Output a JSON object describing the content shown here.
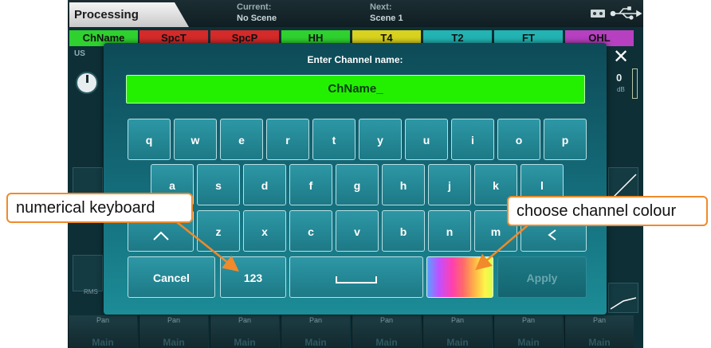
{
  "header": {
    "section": "Processing",
    "current_label": "Current:",
    "current_value": "No Scene",
    "next_label": "Next:",
    "next_value": "Scene 1"
  },
  "channel_tabs": [
    {
      "label": "ChName",
      "color": "#2fd12f"
    },
    {
      "label": "SpcT",
      "color": "#d42a2a"
    },
    {
      "label": "SpcP",
      "color": "#d42a2a"
    },
    {
      "label": "HH",
      "color": "#2fd12f"
    },
    {
      "label": "T4",
      "color": "#d8d21f"
    },
    {
      "label": "T2",
      "color": "#23b3b3"
    },
    {
      "label": "FT",
      "color": "#23b3b3"
    },
    {
      "label": "OHL",
      "color": "#b640c0"
    }
  ],
  "strip": {
    "left_label": "US",
    "meter_value": "0",
    "meter_unit": "dB",
    "rms_label": "RMS"
  },
  "pan_labels": [
    "Pan",
    "Pan",
    "Pan",
    "Pan",
    "Pan",
    "Pan",
    "Pan",
    "Pan"
  ],
  "pan_mains": [
    "Main",
    "Main",
    "Main",
    "Main",
    "Main",
    "Main",
    "Main",
    "Main"
  ],
  "dialog": {
    "title": "Enter Channel name:",
    "value": "ChName_",
    "field_color": "#22f000",
    "row1": [
      "q",
      "w",
      "e",
      "r",
      "t",
      "y",
      "u",
      "i",
      "o",
      "p"
    ],
    "row2": [
      "a",
      "s",
      "d",
      "f",
      "g",
      "h",
      "j",
      "k",
      "l"
    ],
    "row3": [
      "z",
      "x",
      "c",
      "v",
      "b",
      "n",
      "m"
    ],
    "cancel": "Cancel",
    "numeric": "123",
    "apply": "Apply"
  },
  "callouts": {
    "numeric": "numerical  keyboard",
    "colour": "choose channel colour"
  },
  "colors": {
    "accent": "#1d7986",
    "callout_border": "#f08a2b"
  }
}
